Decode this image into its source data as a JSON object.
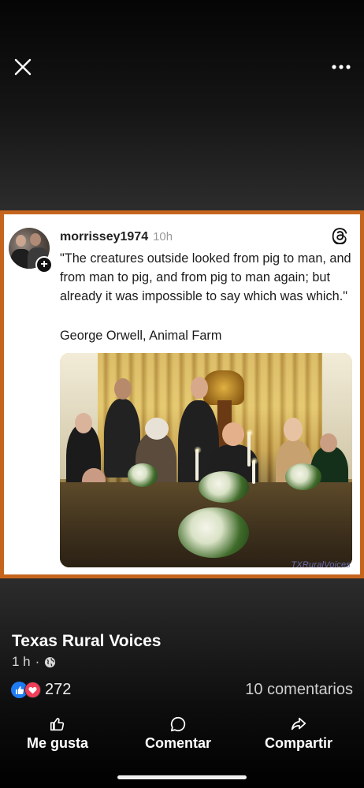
{
  "viewer": {
    "close_icon": "close-icon",
    "more_icon": "more-horizontal-icon"
  },
  "post": {
    "username": "morrissey1974",
    "time_ago": "10h",
    "quote": "\"The creatures outside looked from pig to man, and from man to pig, and from pig to man again; but already it was impossible to say which was which.\"",
    "attribution": "George Orwell, Animal Farm",
    "photo_watermark": "TXRuralVoices",
    "platform_icon": "threads-icon",
    "follow_symbol": "+",
    "frame_color": "#c5651d"
  },
  "page": {
    "name": "Texas Rural Voices",
    "time": "1 h",
    "separator": "·",
    "privacy_icon": "globe-icon"
  },
  "reactions": {
    "count": "272",
    "comments": "10 comentarios",
    "like_color": "#1f7bf2",
    "love_color": "#f33e58"
  },
  "actions": {
    "like_label": "Me gusta",
    "comment_label": "Comentar",
    "share_label": "Compartir"
  }
}
